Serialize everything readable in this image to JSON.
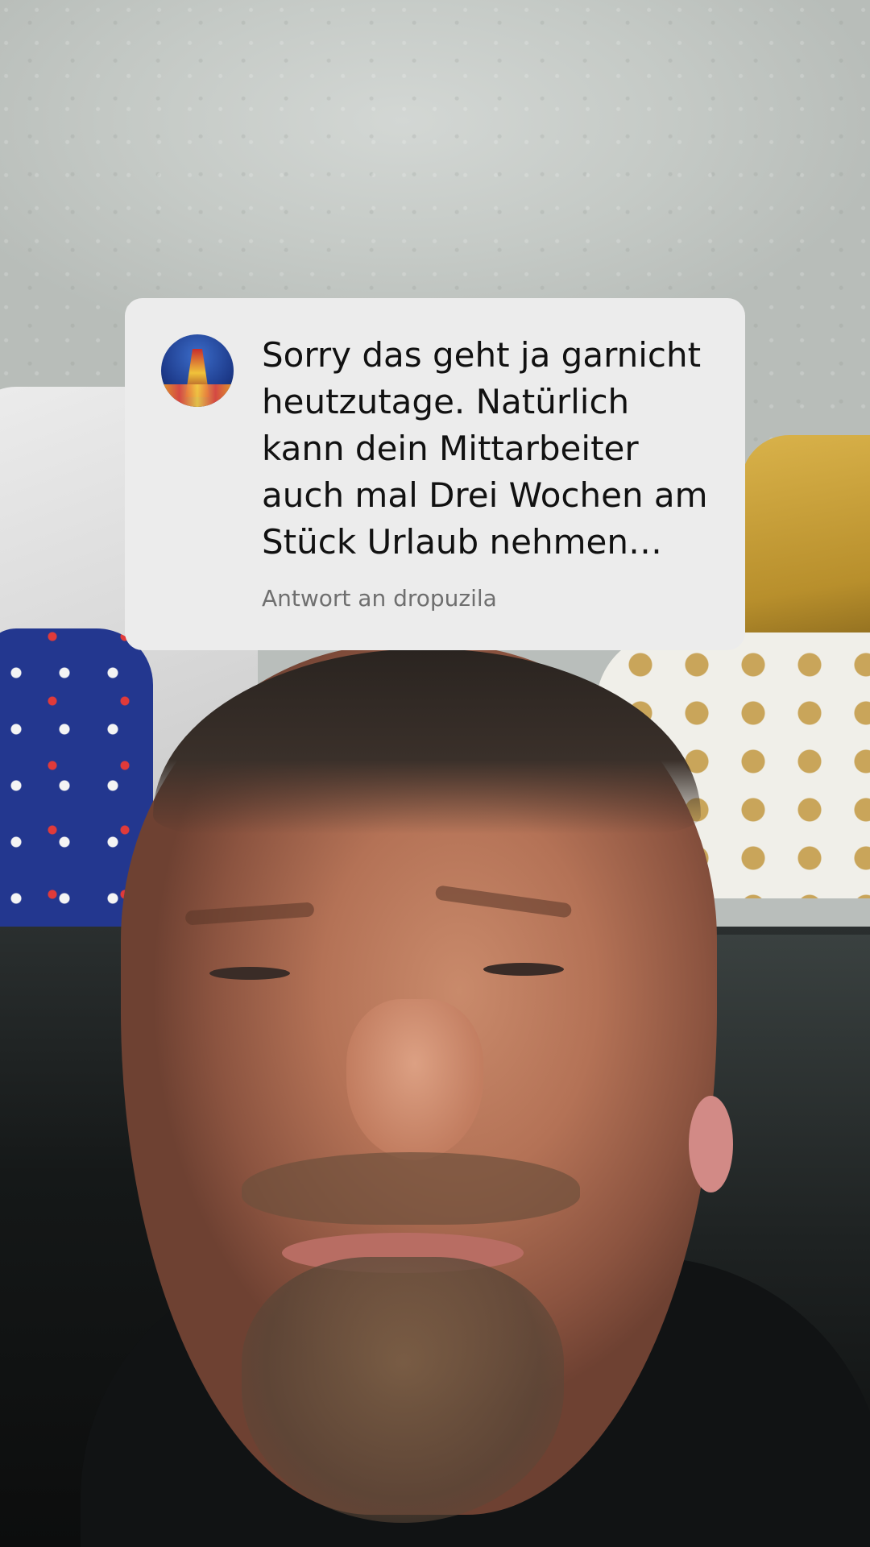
{
  "reply_sticker": {
    "avatar_icon": "user-avatar-icon",
    "comment": "Sorry das geht ja garnicht heutzutage. Natürlich kann dein Mittarbeiter auch mal Drei Wochen am Stück Urlaub nehmen…",
    "reply_to_label": "Antwort an dropuzila",
    "background_color": "#ececec",
    "text_color": "#111111",
    "secondary_text_color": "#6f6f6f"
  }
}
